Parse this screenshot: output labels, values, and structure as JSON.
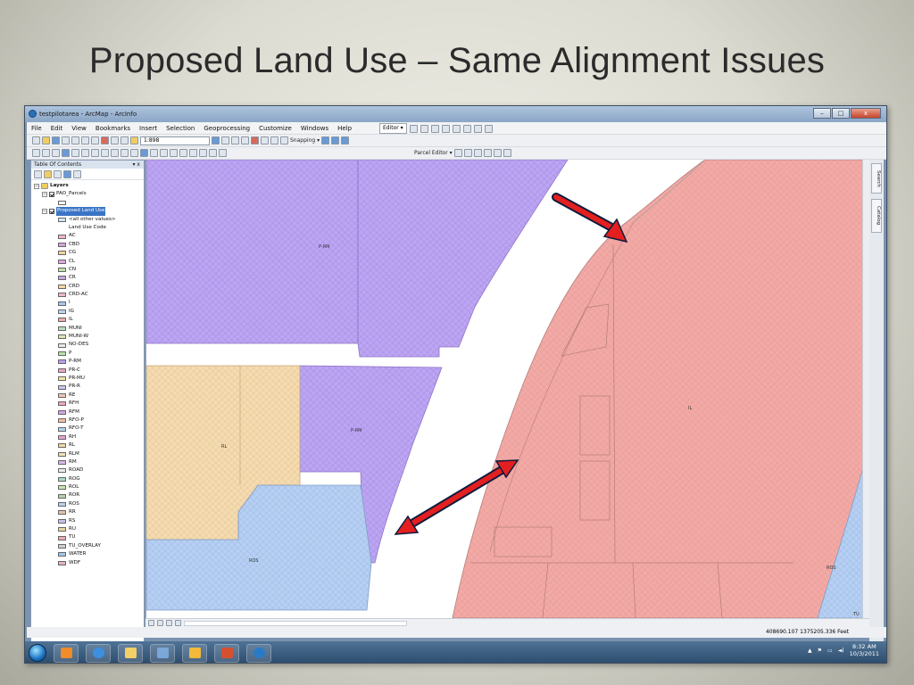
{
  "slide": {
    "title": "Proposed Land Use – Same Alignment Issues"
  },
  "window": {
    "title": "testpilotarea - ArcMap - ArcInfo",
    "minimize": "–",
    "maximize": "□",
    "close": "x"
  },
  "menu": [
    "File",
    "Edit",
    "View",
    "Bookmarks",
    "Insert",
    "Selection",
    "Geoprocessing",
    "Customize",
    "Windows",
    "Help"
  ],
  "editor_toolbar": {
    "editor_label": "Editor ▾",
    "parcel_editor_label": "Parcel Editor ▾"
  },
  "standard_toolbar": {
    "scale": "1:898",
    "snapping_label": "Snapping ▾"
  },
  "toc": {
    "title": "Table Of Contents",
    "pin": "▾ x",
    "layers_label": "Layers",
    "layer1": "PAO_Parcels",
    "layer2": "Proposed Land Use",
    "all_other_values": "<all other values>",
    "field_label": "Land Use Code",
    "legend": [
      {
        "code": "AC",
        "color": "#f2b6c8"
      },
      {
        "code": "CBD",
        "color": "#d8a3e0"
      },
      {
        "code": "CG",
        "color": "#f3d59a"
      },
      {
        "code": "CL",
        "color": "#e0a7e4"
      },
      {
        "code": "CN",
        "color": "#bfe3a6"
      },
      {
        "code": "CR",
        "color": "#c8a4e6"
      },
      {
        "code": "CRD",
        "color": "#f5d7a1"
      },
      {
        "code": "CRD-AC",
        "color": "#f2b7d0"
      },
      {
        "code": "I",
        "color": "#a7c7ef"
      },
      {
        "code": "IG",
        "color": "#bcd6f0"
      },
      {
        "code": "IL",
        "color": "#f2a9a9"
      },
      {
        "code": "MUNI",
        "color": "#b7e1c0"
      },
      {
        "code": "MUNI-W",
        "color": "#d7eab0"
      },
      {
        "code": "NO-DES",
        "color": "#eaeaea"
      },
      {
        "code": "P",
        "color": "#b9e5a4"
      },
      {
        "code": "P-RM",
        "color": "#b9a0f0"
      },
      {
        "code": "PR-C",
        "color": "#e6a6c5"
      },
      {
        "code": "PR-MU",
        "color": "#f4e6a0"
      },
      {
        "code": "PR-R",
        "color": "#d2c3f0"
      },
      {
        "code": "RE",
        "color": "#f5c5b5"
      },
      {
        "code": "RFH",
        "color": "#f0a7b7"
      },
      {
        "code": "RFM",
        "color": "#d3a5e8"
      },
      {
        "code": "RFO-P",
        "color": "#f3bf9f"
      },
      {
        "code": "RFO-T",
        "color": "#b0d6ef"
      },
      {
        "code": "RH",
        "color": "#e7a3d6"
      },
      {
        "code": "RL",
        "color": "#f4d9a6"
      },
      {
        "code": "RLM",
        "color": "#f1e3b3"
      },
      {
        "code": "RM",
        "color": "#d9b4ea"
      },
      {
        "code": "ROAD",
        "color": "#ededed"
      },
      {
        "code": "ROG",
        "color": "#a9dcc0"
      },
      {
        "code": "ROL",
        "color": "#c7e8b0"
      },
      {
        "code": "ROR",
        "color": "#b6d3a4"
      },
      {
        "code": "ROS",
        "color": "#b8d4f2"
      },
      {
        "code": "RR",
        "color": "#e3c4a8"
      },
      {
        "code": "RS",
        "color": "#c6c0ef"
      },
      {
        "code": "RU",
        "color": "#e8d7a0"
      },
      {
        "code": "TU",
        "color": "#f1a9b3"
      },
      {
        "code": "TU_OVERLAY",
        "color": "#d0d0d0"
      },
      {
        "code": "WATER",
        "color": "#9fc8ef"
      },
      {
        "code": "WDF",
        "color": "#e7b2c8"
      }
    ]
  },
  "map": {
    "labels": {
      "prm_top": "P-RM",
      "prm_mid": "P-RM",
      "rl": "RL",
      "ros_left": "ROS",
      "ros_right": "ROS",
      "il": "IL",
      "tu": "TU"
    },
    "colors": {
      "prm": "#bca5f2",
      "prm_line": "#8f73c9",
      "rl": "#f5dbb0",
      "rl_line": "#c7a878",
      "ros": "#b6cff2",
      "ros_line": "#7e9cc7",
      "il": "#f2aaa6",
      "il_line": "#b47c78",
      "arrow": "#e41f1f",
      "arrow_outline": "#0d1b3d"
    }
  },
  "side_tabs": {
    "search": "Search",
    "catalog": "Catalog"
  },
  "status": {
    "coords": "408690.107  1375205.336 Feet"
  },
  "taskbar": {
    "time": "8:32 AM",
    "date": "10/3/2011"
  }
}
